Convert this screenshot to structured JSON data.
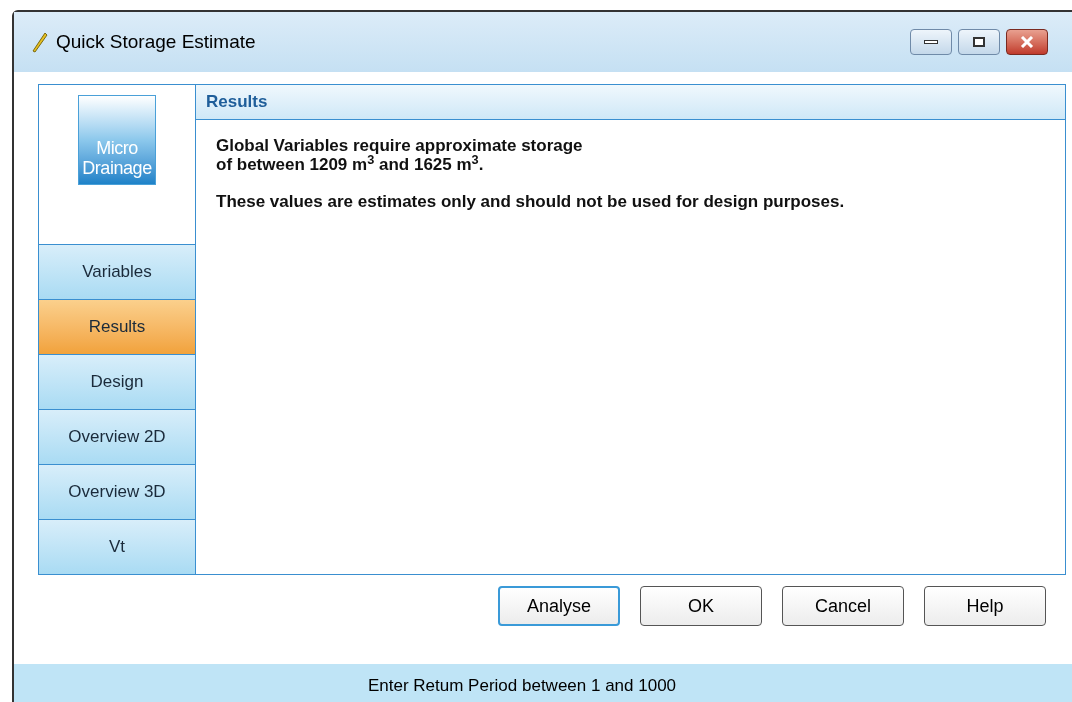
{
  "window": {
    "title": "Quick Storage Estimate"
  },
  "logo": {
    "lines": [
      "Micro",
      "Drainage"
    ]
  },
  "nav": [
    {
      "label": "Variables",
      "selected": false
    },
    {
      "label": "Results",
      "selected": true
    },
    {
      "label": "Design",
      "selected": false
    },
    {
      "label": "Overview 2D",
      "selected": false
    },
    {
      "label": "Overview 3D",
      "selected": false
    },
    {
      "label": "Vt",
      "selected": false
    }
  ],
  "panel": {
    "title": "Results",
    "paragraphs": [
      "Global Variables require approximate storage\nof between 1209 m$^{3}$ and 1625 m$^{3}$.",
      "These values are estimates only and should not be used for design purposes."
    ]
  },
  "buttons": [
    {
      "label": "Analyse",
      "focused": true
    },
    {
      "label": "OK",
      "focused": false
    },
    {
      "label": "Cancel",
      "focused": false
    },
    {
      "label": "Help",
      "focused": false
    }
  ],
  "status_bar": "Enter Retum Period between 1 and 1000"
}
